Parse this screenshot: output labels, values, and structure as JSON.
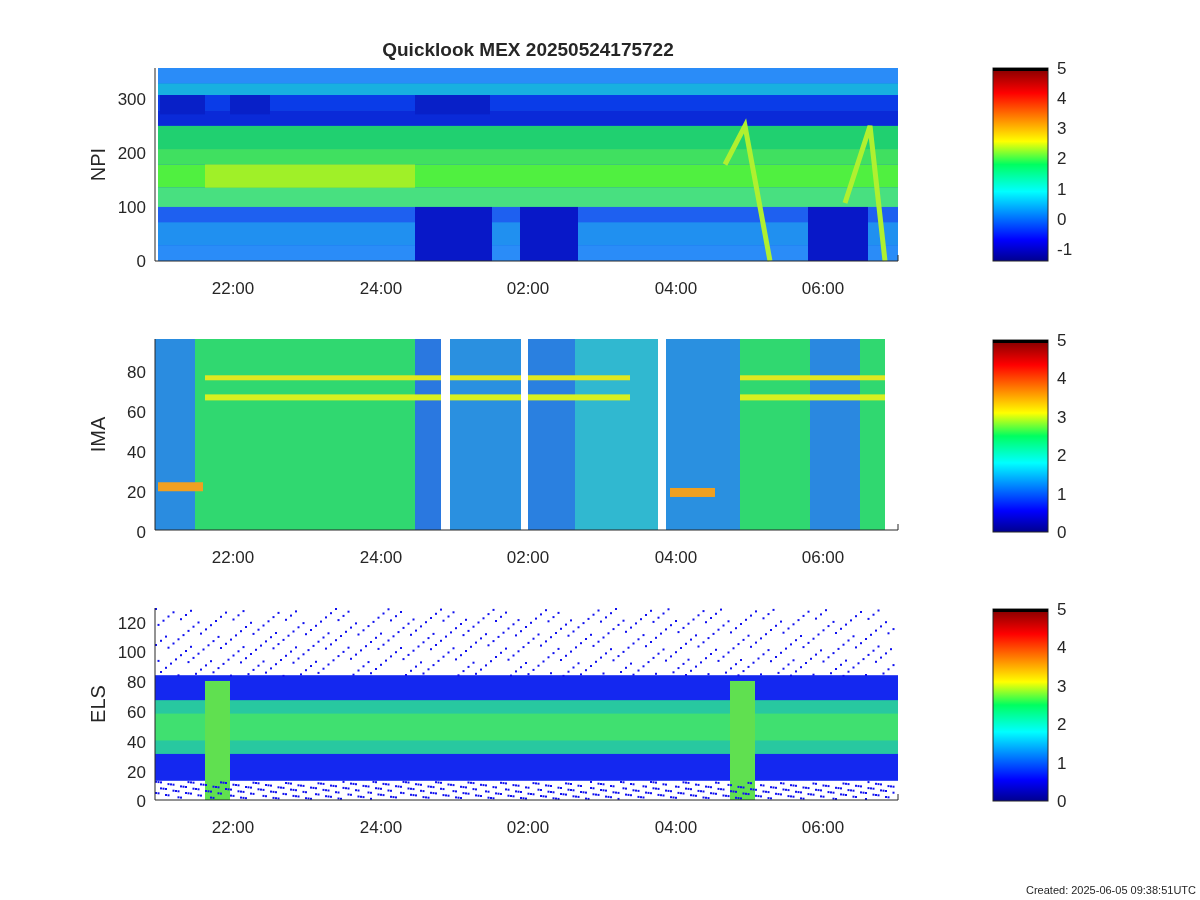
{
  "title": "Quicklook MEX 20250524175722",
  "panels": [
    {
      "kind": "bands",
      "ylabel": "NPI",
      "yticks": [
        "300",
        "200",
        "100",
        "0"
      ],
      "xticks": [
        "22:00",
        "24:00",
        "02:00",
        "04:00",
        "06:00"
      ],
      "colorbar_ticks": [
        "5",
        "4",
        "3",
        "2",
        "1",
        "0",
        "-1"
      ]
    },
    {
      "kind": "gapped",
      "ylabel": "IMA",
      "yticks": [
        "80",
        "60",
        "40",
        "20",
        "0"
      ],
      "xticks": [
        "22:00",
        "24:00",
        "02:00",
        "04:00",
        "06:00"
      ],
      "colorbar_ticks": [
        "5",
        "4",
        "3",
        "2",
        "1",
        "0"
      ]
    },
    {
      "kind": "scatter",
      "ylabel": "ELS",
      "yticks": [
        "120",
        "100",
        "80",
        "60",
        "40",
        "20",
        "0"
      ],
      "xticks": [
        "22:00",
        "24:00",
        "02:00",
        "04:00",
        "06:00"
      ],
      "colorbar_ticks": [
        "5",
        "4",
        "3",
        "2",
        "1",
        "0"
      ]
    }
  ],
  "footer": "Created: 2025-06-05 09:38:51UTC"
}
